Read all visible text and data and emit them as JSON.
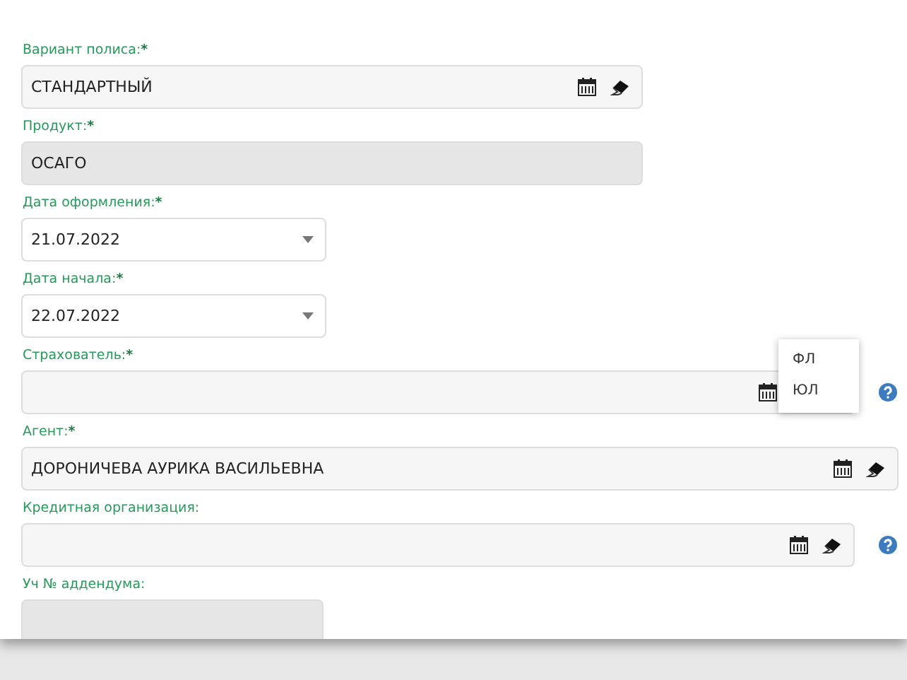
{
  "fields": [
    {
      "label": "Вариант полиса:",
      "required_mark": "*",
      "kind": "lookup",
      "value": "СТАНДАРТНЫЙ",
      "clearable": true,
      "help": false
    },
    {
      "label": "Продукт:",
      "required_mark": "*",
      "kind": "disabled",
      "value": "ОСАГО",
      "help": false
    },
    {
      "label": "Дата оформления:",
      "required_mark": "*",
      "kind": "select",
      "value": "21.07.2022",
      "help": false
    },
    {
      "label": "Дата начала:",
      "required_mark": "*",
      "kind": "select",
      "value": "22.07.2022",
      "help": false
    },
    {
      "label": "Страхователь:",
      "required_mark": "*",
      "kind": "lookup",
      "clearable": false,
      "help": true,
      "menu": [
        {
          "label": "ФЛ"
        },
        {
          "label": "ЮЛ"
        }
      ]
    },
    {
      "label": "Агент:",
      "required_mark": "*",
      "kind": "lookup",
      "value": "ДОРОНИЧЕВА АУРИКА ВАСИЛЬЕВНА",
      "clearable": true,
      "help": false
    },
    {
      "label": "Кредитная организация:",
      "kind": "lookup",
      "clearable": true,
      "help": true
    },
    {
      "label": "Уч № аддендума:",
      "kind": "disabled",
      "help": false
    }
  ]
}
